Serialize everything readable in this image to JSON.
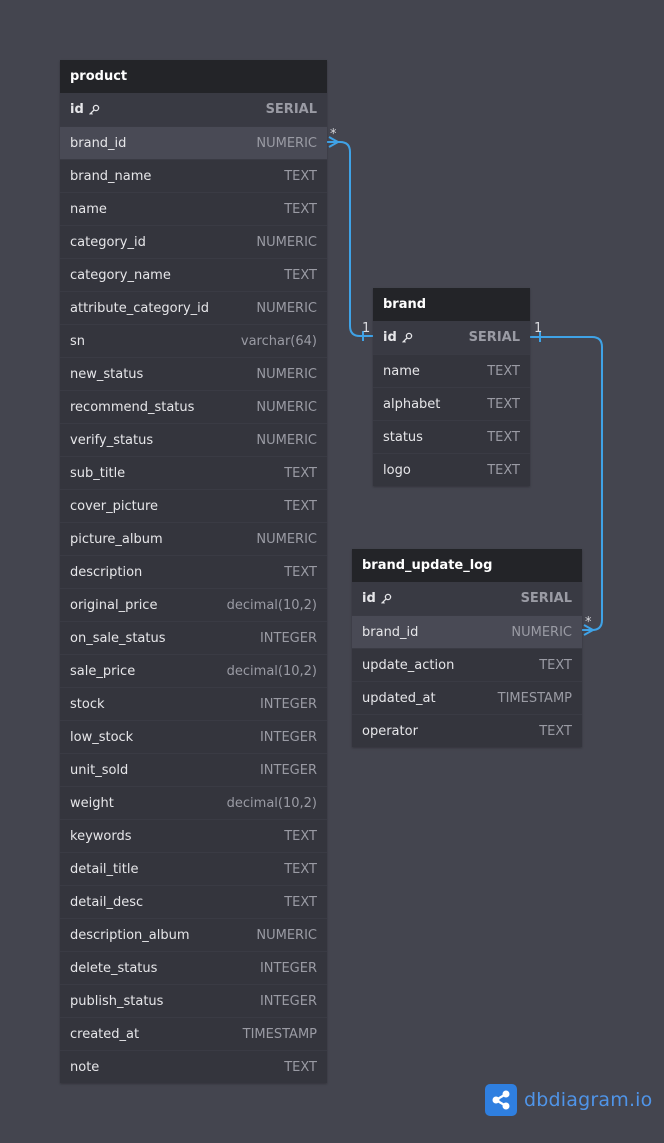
{
  "tables": {
    "product": {
      "name": "product",
      "fields": [
        {
          "name": "id",
          "type": "SERIAL"
        },
        {
          "name": "brand_id",
          "type": "NUMERIC"
        },
        {
          "name": "brand_name",
          "type": "TEXT"
        },
        {
          "name": "name",
          "type": "TEXT"
        },
        {
          "name": "category_id",
          "type": "NUMERIC"
        },
        {
          "name": "category_name",
          "type": "TEXT"
        },
        {
          "name": "attribute_category_id",
          "type": "NUMERIC"
        },
        {
          "name": "sn",
          "type": "varchar(64)"
        },
        {
          "name": "new_status",
          "type": "NUMERIC"
        },
        {
          "name": "recommend_status",
          "type": "NUMERIC"
        },
        {
          "name": "verify_status",
          "type": "NUMERIC"
        },
        {
          "name": "sub_title",
          "type": "TEXT"
        },
        {
          "name": "cover_picture",
          "type": "TEXT"
        },
        {
          "name": "picture_album",
          "type": "NUMERIC"
        },
        {
          "name": "description",
          "type": "TEXT"
        },
        {
          "name": "original_price",
          "type": "decimal(10,2)"
        },
        {
          "name": "on_sale_status",
          "type": "INTEGER"
        },
        {
          "name": "sale_price",
          "type": "decimal(10,2)"
        },
        {
          "name": "stock",
          "type": "INTEGER"
        },
        {
          "name": "low_stock",
          "type": "INTEGER"
        },
        {
          "name": "unit_sold",
          "type": "INTEGER"
        },
        {
          "name": "weight",
          "type": "decimal(10,2)"
        },
        {
          "name": "keywords",
          "type": "TEXT"
        },
        {
          "name": "detail_title",
          "type": "TEXT"
        },
        {
          "name": "detail_desc",
          "type": "TEXT"
        },
        {
          "name": "description_album",
          "type": "NUMERIC"
        },
        {
          "name": "delete_status",
          "type": "INTEGER"
        },
        {
          "name": "publish_status",
          "type": "INTEGER"
        },
        {
          "name": "created_at",
          "type": "TIMESTAMP"
        },
        {
          "name": "note",
          "type": "TEXT"
        }
      ]
    },
    "brand": {
      "name": "brand",
      "fields": [
        {
          "name": "id",
          "type": "SERIAL"
        },
        {
          "name": "name",
          "type": "TEXT"
        },
        {
          "name": "alphabet",
          "type": "TEXT"
        },
        {
          "name": "status",
          "type": "TEXT"
        },
        {
          "name": "logo",
          "type": "TEXT"
        }
      ]
    },
    "brand_update_log": {
      "name": "brand_update_log",
      "fields": [
        {
          "name": "id",
          "type": "SERIAL"
        },
        {
          "name": "brand_id",
          "type": "NUMERIC"
        },
        {
          "name": "update_action",
          "type": "TEXT"
        },
        {
          "name": "updated_at",
          "type": "TIMESTAMP"
        },
        {
          "name": "operator",
          "type": "TEXT"
        }
      ]
    }
  },
  "relationships": [
    {
      "from_table": "product",
      "from_field": "brand_id",
      "from_card": "*",
      "to_table": "brand",
      "to_field": "id",
      "to_card": "1"
    },
    {
      "from_table": "brand_update_log",
      "from_field": "brand_id",
      "from_card": "*",
      "to_table": "brand",
      "to_field": "id",
      "to_card": "1"
    }
  ],
  "colors": {
    "background": "#44454f",
    "table_header": "#232428",
    "link": "#3fa2e6",
    "brand_accent": "#2f7fe0"
  },
  "branding": {
    "logo_icon": "share-nodes-icon",
    "name": "dbdiagram",
    "suffix": ".io"
  }
}
